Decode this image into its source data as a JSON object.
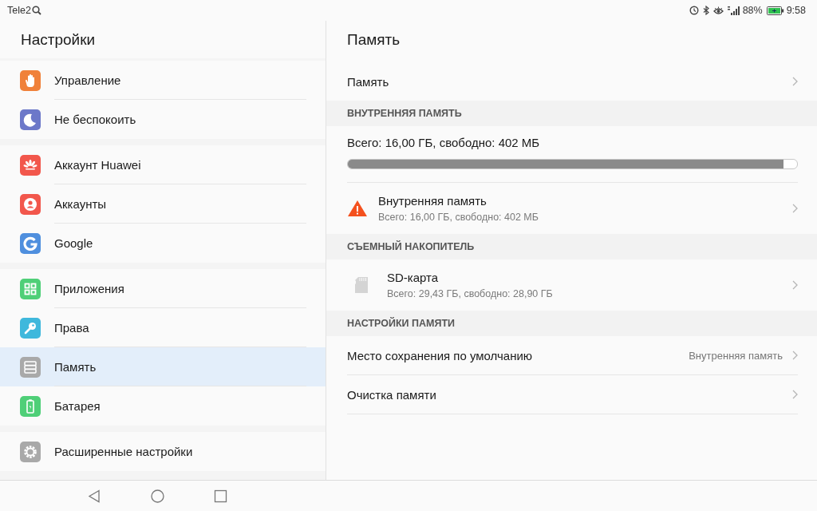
{
  "status_bar": {
    "carrier": "Tele2",
    "battery": "88%",
    "time": "9:58"
  },
  "sidebar": {
    "title": "Настройки",
    "groups": [
      {
        "items": [
          {
            "label": "Управление",
            "kind": "hand",
            "color": "#f0813a",
            "selected": false
          },
          {
            "label": "Не беспокоить",
            "kind": "moon",
            "color": "#6c78c9",
            "selected": false
          }
        ]
      },
      {
        "items": [
          {
            "label": "Аккаунт Huawei",
            "kind": "petals",
            "color": "#f2574c",
            "selected": false
          },
          {
            "label": "Аккаунты",
            "kind": "person",
            "color": "#f2574c",
            "selected": false
          },
          {
            "label": "Google",
            "kind": "g",
            "color": "#4f8fde",
            "selected": false
          }
        ]
      },
      {
        "items": [
          {
            "label": "Приложения",
            "kind": "apps",
            "color": "#4fcf78",
            "selected": false
          },
          {
            "label": "Права",
            "kind": "key",
            "color": "#3fb8dc",
            "selected": false
          },
          {
            "label": "Память",
            "kind": "storage",
            "color": "#a9a9a9",
            "selected": true
          },
          {
            "label": "Батарея",
            "kind": "battery",
            "color": "#4fcf78",
            "selected": false
          }
        ]
      },
      {
        "items": [
          {
            "label": "Расширенные настройки",
            "kind": "gear",
            "color": "#a9a9a9",
            "selected": false
          }
        ]
      }
    ]
  },
  "detail": {
    "title": "Память",
    "items": [
      {
        "kind": "link",
        "label": "Память"
      },
      {
        "kind": "header",
        "label": "ВНУТРЕННЯЯ ПАМЯТЬ"
      },
      {
        "kind": "usage",
        "label": "Всего: 16,00 ГБ, свободно: 402 МБ",
        "level": 0.97
      },
      {
        "kind": "internal",
        "label": "Внутренняя память",
        "summary": "Всего: 16,00 ГБ, свободно: 402 МБ"
      },
      {
        "kind": "header",
        "label": "СЪЕМНЫЙ НАКОПИТЕЛЬ"
      },
      {
        "kind": "removable",
        "label": "SD-карта",
        "summary": "Всего: 29,43 ГБ, свободно: 28,90 ГБ"
      },
      {
        "kind": "header",
        "label": "НАСТРОЙКИ ПАМЯТИ"
      },
      {
        "kind": "link",
        "label": "Место сохранения по умолчанию",
        "value": "Внутренняя память"
      },
      {
        "kind": "link",
        "label": "Очистка памяти"
      }
    ]
  }
}
